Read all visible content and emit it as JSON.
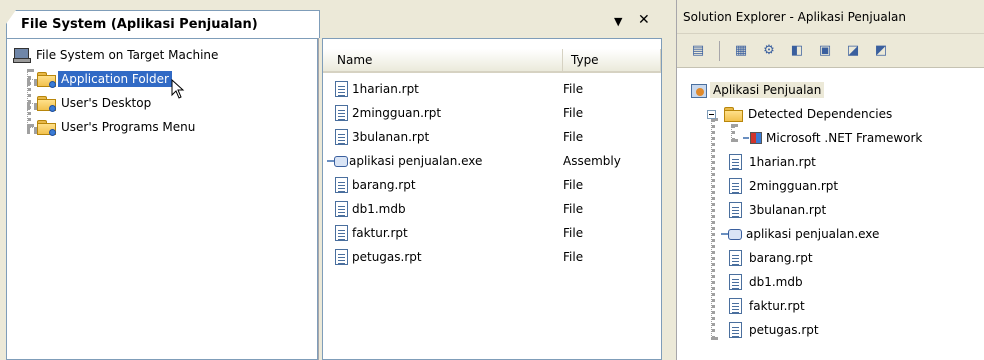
{
  "doc_tab": {
    "title": "File System (Aplikasi Penjualan)",
    "dropdown_glyph": "▼",
    "close_glyph": "✕"
  },
  "file_system_tree": {
    "root": {
      "label": "File System on Target Machine",
      "icon": "computer-icon"
    },
    "children": [
      {
        "label": "Application Folder",
        "icon": "folder-icon",
        "selected": true
      },
      {
        "label": "User's Desktop",
        "icon": "folder-icon",
        "selected": false
      },
      {
        "label": "User's Programs Menu",
        "icon": "folder-icon",
        "selected": false
      }
    ]
  },
  "file_list": {
    "columns": [
      "Name",
      "Type"
    ],
    "rows": [
      {
        "name": "1harian.rpt",
        "type": "File",
        "icon": "document-icon"
      },
      {
        "name": "2mingguan.rpt",
        "type": "File",
        "icon": "document-icon"
      },
      {
        "name": "3bulanan.rpt",
        "type": "File",
        "icon": "document-icon"
      },
      {
        "name": "aplikasi penjualan.exe",
        "type": "Assembly",
        "icon": "assembly-icon"
      },
      {
        "name": "barang.rpt",
        "type": "File",
        "icon": "document-icon"
      },
      {
        "name": "db1.mdb",
        "type": "File",
        "icon": "document-icon"
      },
      {
        "name": "faktur.rpt",
        "type": "File",
        "icon": "document-icon"
      },
      {
        "name": "petugas.rpt",
        "type": "File",
        "icon": "document-icon"
      }
    ]
  },
  "solution_explorer": {
    "title": "Solution Explorer - Aplikasi Penjualan",
    "toolbar_icons": [
      "properties-icon",
      "file-system-editor-icon",
      "registry-editor-icon",
      "file-types-editor-icon",
      "user-interface-editor-icon",
      "custom-actions-editor-icon",
      "launch-conditions-editor-icon"
    ],
    "project": "Aplikasi Penjualan",
    "dependencies_folder": "Detected Dependencies",
    "dependencies": [
      "Microsoft .NET Framework"
    ],
    "files": [
      {
        "name": "1harian.rpt",
        "icon": "document-icon"
      },
      {
        "name": "2mingguan.rpt",
        "icon": "document-icon"
      },
      {
        "name": "3bulanan.rpt",
        "icon": "document-icon"
      },
      {
        "name": "aplikasi penjualan.exe",
        "icon": "assembly-icon"
      },
      {
        "name": "barang.rpt",
        "icon": "document-icon"
      },
      {
        "name": "db1.mdb",
        "icon": "document-icon"
      },
      {
        "name": "faktur.rpt",
        "icon": "document-icon"
      },
      {
        "name": "petugas.rpt",
        "icon": "document-icon"
      }
    ]
  },
  "colors": {
    "selection": "#316ac5",
    "window_bg": "#ece9d8",
    "border": "#7f9db9"
  }
}
